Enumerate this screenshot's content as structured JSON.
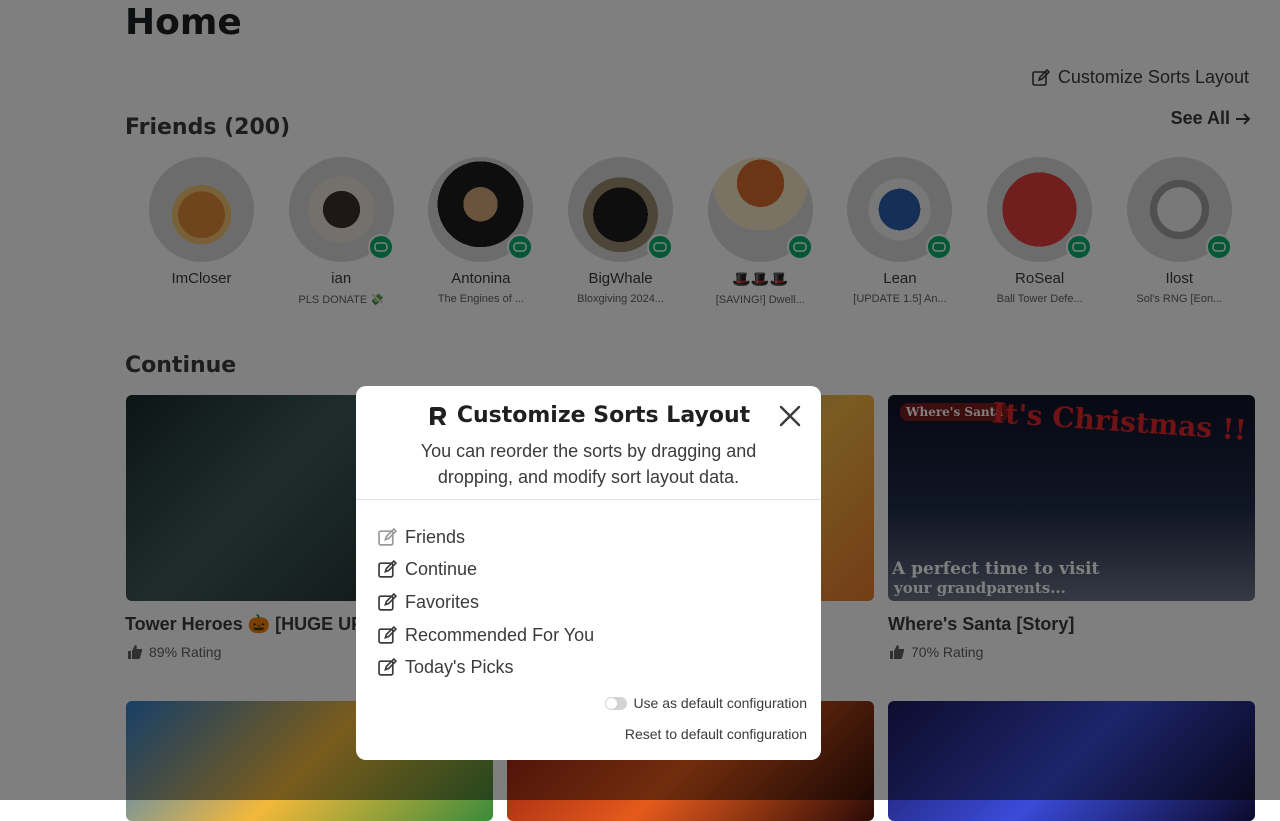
{
  "page": {
    "title": "Home"
  },
  "toolbar": {
    "customize_label": "Customize Sorts Layout"
  },
  "friends": {
    "heading": "Friends (200)",
    "see_all": "See All",
    "items": [
      {
        "name": "ImCloser",
        "game": ""
      },
      {
        "name": "ian",
        "game": "PLS DONATE 💸"
      },
      {
        "name": "Antonina",
        "game": "The Engines of ..."
      },
      {
        "name": "BigWhale",
        "game": "Bloxgiving 2024..."
      },
      {
        "name": "🎩🎩🎩",
        "game": "[SAVING!] Dwell..."
      },
      {
        "name": "Lean",
        "game": "[UPDATE 1.5] An..."
      },
      {
        "name": "RoSeal",
        "game": "Ball Tower Defe..."
      },
      {
        "name": "Ilost",
        "game": "Sol's RNG [Eon..."
      }
    ]
  },
  "continue": {
    "heading": "Continue",
    "tiles": [
      {
        "name": "Tower Heroes 🎃 [HUGE UP",
        "rating": "89% Rating"
      },
      {
        "name": "",
        "rating": ""
      },
      {
        "name": "Where's Santa [Story]",
        "rating": "70% Rating",
        "art_line1": "It's Christmas !!",
        "art_line2": "A perfect time to visit",
        "art_line3": "your grandparents...",
        "art_logo": "Where's Santa"
      }
    ]
  },
  "modal": {
    "title": "Customize Sorts Layout",
    "description": "You can reorder the sorts by dragging and dropping, and modify sort layout data.",
    "items": [
      {
        "label": "Friends"
      },
      {
        "label": "Continue"
      },
      {
        "label": "Favorites"
      },
      {
        "label": "Recommended For You"
      },
      {
        "label": "Today's Picks"
      }
    ],
    "default_toggle_label": "Use as default configuration",
    "default_toggle_on": false,
    "reset_label": "Reset to default configuration"
  },
  "colors": {
    "presence": "#00b06f",
    "overlay": "rgba(0,0,0,0.5)"
  }
}
